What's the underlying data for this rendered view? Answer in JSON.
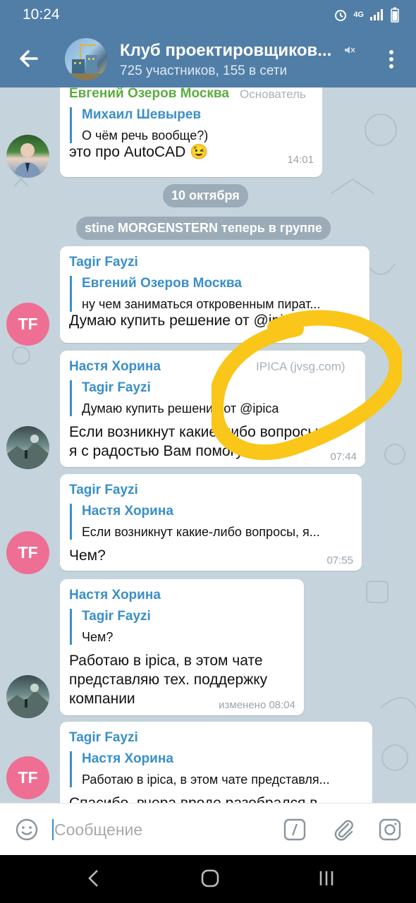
{
  "status_bar": {
    "time": "10:24",
    "network": "4G"
  },
  "header": {
    "title": "Клуб проектировщиков...",
    "subtitle": "725 участников, 155 в сети"
  },
  "messages": [
    {
      "sender": "Евгений Озеров Москва",
      "role": "Основатель",
      "reply_name": "Михаил Шевырев",
      "reply_text": "О чём речь вообще?)",
      "text": "это про AutoCAD 😉",
      "time": "14:01"
    },
    {
      "sender": "Tagir Fayzi",
      "reply_name": "Евгений Озеров Москва",
      "reply_text": "ну чем заниматься откровенным пират...",
      "text": "Думаю купить решение от @ipica"
    },
    {
      "sender": "Настя Хорина",
      "role": "IPICA (jvsg.com)",
      "reply_name": "Tagir Fayzi",
      "reply_text": "Думаю купить решение от @ipica",
      "text_lines": [
        "Если возникнут какие-либо вопросы,",
        "я с радостью Вам помогу."
      ],
      "time": "07:44"
    },
    {
      "sender": "Tagir Fayzi",
      "reply_name": "Настя Хорина",
      "reply_text": "Если возникнут какие-либо вопросы, я...",
      "text": "Чем?",
      "time": "07:55"
    },
    {
      "sender": "Настя Хорина",
      "reply_name": "Tagir Fayzi",
      "reply_text": "Чем?",
      "text_lines": [
        "Работаю в ipica, в этом чате",
        "представляю тех. поддержку",
        "компании"
      ],
      "time": "изменено 08:04"
    },
    {
      "sender": "Tagir Fayzi",
      "reply_name": "Настя Хорина",
      "reply_text": "Работаю в ipica, в этом чате представля...",
      "text": "Спасибо, вчера вроде разобрался в"
    }
  ],
  "service": {
    "date": "10 октября",
    "join": "stine MORGENSTERN теперь в группе"
  },
  "avatars": {
    "tf_initials": "TF"
  },
  "input": {
    "placeholder": "Сообщение"
  },
  "colors": {
    "header": "#517ea6",
    "accent": "#3a8fc9",
    "founder": "#5aad3f",
    "tf_avatar": "#ee6f93",
    "highlight": "#f9c619"
  }
}
